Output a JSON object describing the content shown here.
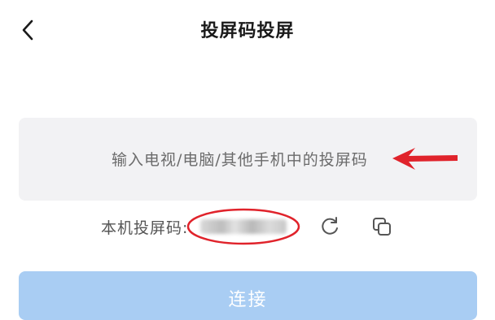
{
  "header": {
    "back_icon": "chevron-left-icon",
    "title": "投屏码投屏"
  },
  "input": {
    "placeholder": "输入电视/电脑/其他手机中的投屏码",
    "annotation_color": "#e0232b"
  },
  "local_code": {
    "label": "本机投屏码:",
    "value": "",
    "refresh_icon": "refresh-icon",
    "copy_icon": "copy-icon"
  },
  "actions": {
    "connect_label": "连接",
    "connect_color": "#a9cdf3"
  }
}
